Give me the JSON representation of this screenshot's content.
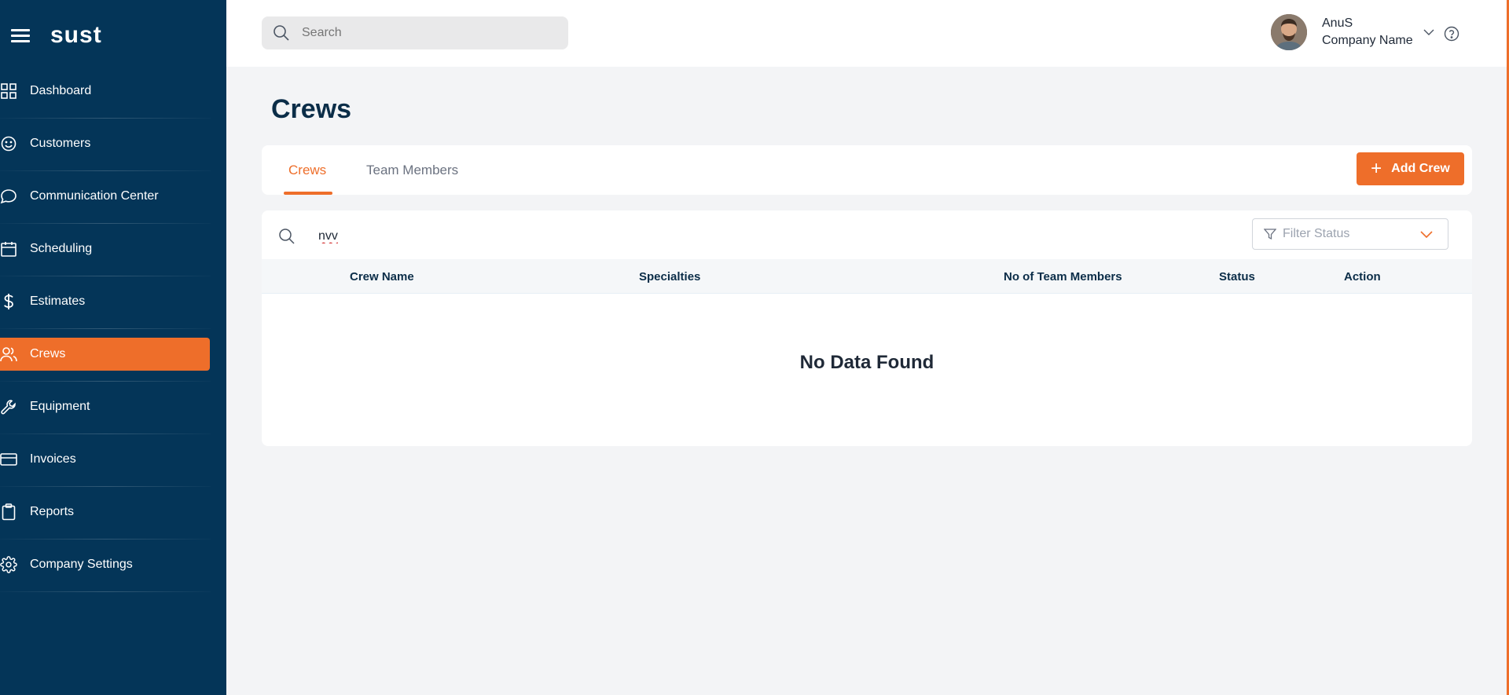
{
  "brand": {
    "logo_text": "sust"
  },
  "sidebar": {
    "items": [
      {
        "label": "Dashboard",
        "icon": "dashboard-icon",
        "active": false
      },
      {
        "label": "Customers",
        "icon": "smiley-icon",
        "active": false
      },
      {
        "label": "Communication Center",
        "icon": "chat-bubble-icon",
        "active": false
      },
      {
        "label": "Scheduling",
        "icon": "calendar-icon",
        "active": false
      },
      {
        "label": "Estimates",
        "icon": "dollar-icon",
        "active": false
      },
      {
        "label": "Crews",
        "icon": "users-icon",
        "active": true
      },
      {
        "label": "Equipment",
        "icon": "wrench-icon",
        "active": false
      },
      {
        "label": "Invoices",
        "icon": "credit-card-icon",
        "active": false
      },
      {
        "label": "Reports",
        "icon": "clipboard-icon",
        "active": false
      },
      {
        "label": "Company Settings",
        "icon": "gear-icon",
        "active": false
      }
    ]
  },
  "topbar": {
    "search_placeholder": "Search",
    "user_name": "AnuS",
    "company_name": "Company Name"
  },
  "page": {
    "title": "Crews",
    "tabs": [
      {
        "label": "Crews",
        "active": true
      },
      {
        "label": "Team Members",
        "active": false
      }
    ],
    "add_button_label": "Add Crew",
    "table_search_value": "nvv",
    "filter_placeholder": "Filter Status",
    "columns": [
      "Crew Name",
      "Specialties",
      "No of Team Members",
      "Status",
      "Action"
    ],
    "empty_message": "No Data Found"
  },
  "colors": {
    "sidebar_bg": "#043558",
    "accent": "#ee6e2a",
    "page_bg": "#f3f4f6"
  }
}
